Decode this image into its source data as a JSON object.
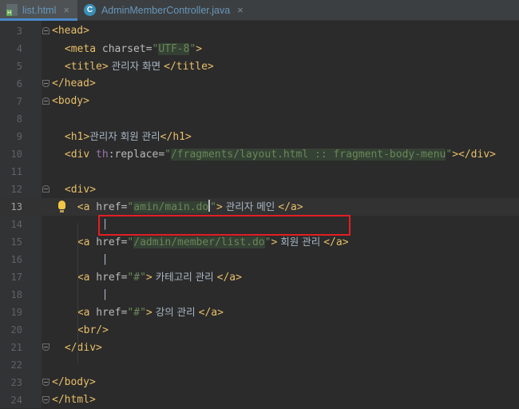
{
  "tabs": [
    {
      "name": "list.html",
      "active": true,
      "icon": "html-file-icon",
      "badge": "H"
    },
    {
      "name": "AdminMemberController.java",
      "active": false,
      "icon": "java-class-icon",
      "badge": "C"
    }
  ],
  "close_glyph": "×",
  "editor": {
    "current_line": 13,
    "lines": [
      {
        "n": "3",
        "code": "<head>"
      },
      {
        "n": "4",
        "code": "    <meta charset=\"UTF-8\">"
      },
      {
        "n": "5",
        "code": "    <title> 관리자 화면 </title>"
      },
      {
        "n": "6",
        "code": "</head>"
      },
      {
        "n": "7",
        "code": "<body>"
      },
      {
        "n": "8",
        "code": ""
      },
      {
        "n": "9",
        "code": "    <h1>관리자 회원 관리</h1>"
      },
      {
        "n": "10",
        "code": "    <div th:replace=\"/fragments/layout.html :: fragment-body-menu\"></div>"
      },
      {
        "n": "11",
        "code": ""
      },
      {
        "n": "12",
        "code": "    <div>"
      },
      {
        "n": "13",
        "code": "        <a href=\"amin/main.do\"> 관리자 메인 </a>"
      },
      {
        "n": "14",
        "code": "        |"
      },
      {
        "n": "15",
        "code": "        <a href=\"/admin/member/list.do\"> 회원 관리 </a>"
      },
      {
        "n": "16",
        "code": "        |"
      },
      {
        "n": "17",
        "code": "        <a href=\"#\"> 카테고리 관리 </a>"
      },
      {
        "n": "18",
        "code": "        |"
      },
      {
        "n": "19",
        "code": "        <a href=\"#\"> 강의 관리 </a>"
      },
      {
        "n": "20",
        "code": "        <br/>"
      },
      {
        "n": "21",
        "code": "    </div>"
      },
      {
        "n": "22",
        "code": ""
      },
      {
        "n": "23",
        "code": "</body>"
      },
      {
        "n": "24",
        "code": "</html>"
      }
    ]
  },
  "colors": {
    "background": "#2b2b2b",
    "gutter": "#313335",
    "tag": "#e8bf6a",
    "attribute": "#bababa",
    "namespace": "#9876aa",
    "string": "#6a8759",
    "text": "#a9b7c6",
    "highlight_box": "#e31e24"
  }
}
